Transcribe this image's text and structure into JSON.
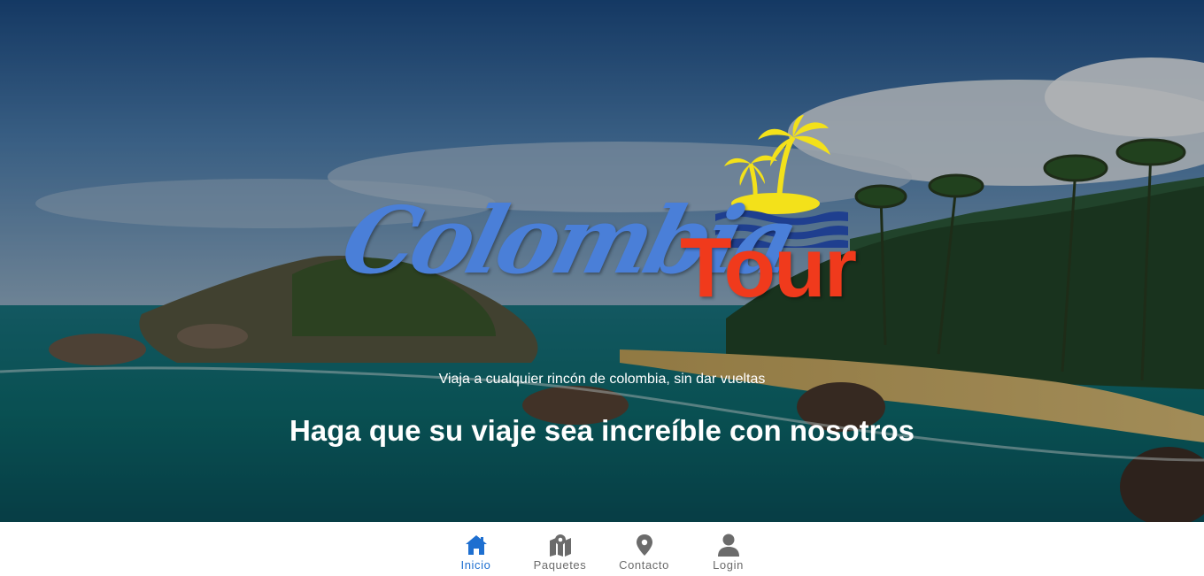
{
  "hero": {
    "logo": {
      "script_text": "Colombia",
      "tour_text": "Tour",
      "icon": "palm-island-logo-icon",
      "colors": {
        "script": "#4a7fd8",
        "tour": "#f03a1c",
        "palm": "#f3e11a",
        "waves": "#1f3f8f"
      }
    },
    "tagline": "Viaja a cualquier rincón de colombia, sin dar vueltas",
    "headline": "Haga que su viaje sea increíble con nosotros"
  },
  "bottom_nav": {
    "active_color": "#1e6fd0",
    "inactive_color": "#6b6b6b",
    "items": [
      {
        "label": "Inicio",
        "icon": "home-icon",
        "active": true
      },
      {
        "label": "Paquetes",
        "icon": "map-icon",
        "active": false
      },
      {
        "label": "Contacto",
        "icon": "location-pin-icon",
        "active": false
      },
      {
        "label": "Login",
        "icon": "user-icon",
        "active": false
      }
    ]
  }
}
